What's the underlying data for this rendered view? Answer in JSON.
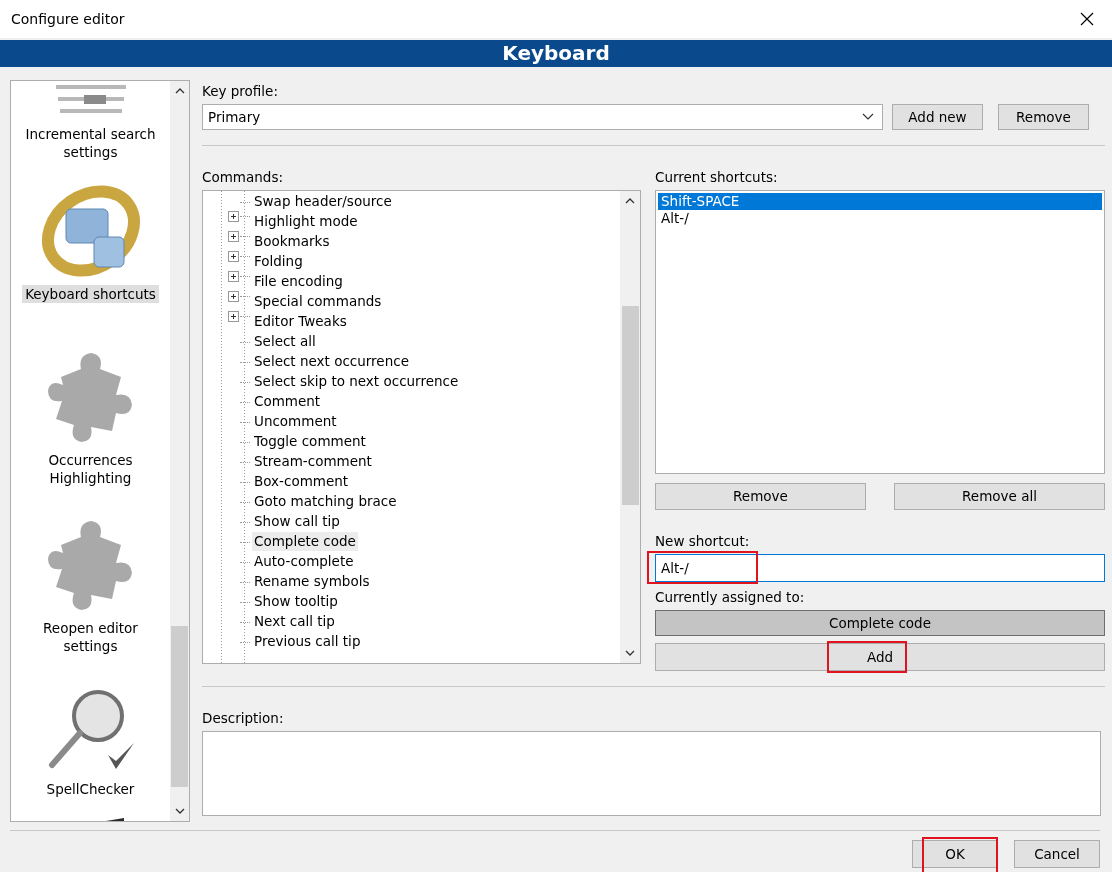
{
  "window": {
    "title": "Configure editor"
  },
  "header": {
    "title": "Keyboard"
  },
  "sidebar": {
    "items": [
      {
        "label": "Incremental search settings",
        "kind": "text",
        "selected": false
      },
      {
        "label": "Keyboard shortcuts",
        "kind": "keyring",
        "selected": true
      },
      {
        "label": "Occurrences Highlighting",
        "kind": "puzzle",
        "selected": false
      },
      {
        "label": "Reopen editor settings",
        "kind": "puzzle",
        "selected": false
      },
      {
        "label": "SpellChecker",
        "kind": "spell",
        "selected": false
      },
      {
        "kind": "toolbar",
        "selected": false
      }
    ]
  },
  "key_profile": {
    "label": "Key profile:",
    "value": "Primary",
    "buttons": [
      {
        "label": "Add new"
      },
      {
        "label": "Remove"
      }
    ]
  },
  "commands": {
    "label": "Commands:",
    "items": [
      {
        "label": "Swap header/source",
        "kind": "leaf",
        "selected": false
      },
      {
        "label": "Highlight mode",
        "kind": "group",
        "expanded": false,
        "selected": false
      },
      {
        "label": "Bookmarks",
        "kind": "group",
        "expanded": false,
        "selected": false
      },
      {
        "label": "Folding",
        "kind": "group",
        "expanded": false,
        "selected": false
      },
      {
        "label": "File encoding",
        "kind": "group",
        "expanded": false,
        "selected": false
      },
      {
        "label": "Special commands",
        "kind": "group",
        "expanded": false,
        "selected": false
      },
      {
        "label": "Editor Tweaks",
        "kind": "group",
        "expanded": false,
        "selected": false
      },
      {
        "label": "Select all",
        "kind": "leaf",
        "selected": false
      },
      {
        "label": "Select next occurrence",
        "kind": "leaf",
        "selected": false
      },
      {
        "label": "Select skip to next occurrence",
        "kind": "leaf",
        "selected": false
      },
      {
        "label": "Comment",
        "kind": "leaf",
        "selected": false
      },
      {
        "label": "Uncomment",
        "kind": "leaf",
        "selected": false
      },
      {
        "label": "Toggle comment",
        "kind": "leaf",
        "selected": false
      },
      {
        "label": "Stream-comment",
        "kind": "leaf",
        "selected": false
      },
      {
        "label": "Box-comment",
        "kind": "leaf",
        "selected": false
      },
      {
        "label": "Goto matching brace",
        "kind": "leaf",
        "selected": false
      },
      {
        "label": "Show call tip",
        "kind": "leaf",
        "selected": false
      },
      {
        "label": "Complete code",
        "kind": "leaf",
        "selected": true
      },
      {
        "label": "Auto-complete",
        "kind": "leaf",
        "selected": false
      },
      {
        "label": "Rename symbols",
        "kind": "leaf",
        "selected": false
      },
      {
        "label": "Show tooltip",
        "kind": "leaf",
        "selected": false
      },
      {
        "label": "Next call tip",
        "kind": "leaf",
        "selected": false
      },
      {
        "label": "Previous call tip",
        "kind": "leaf",
        "selected": false
      }
    ]
  },
  "current_shortcuts": {
    "label": "Current shortcuts:",
    "items": [
      {
        "label": "Shift-SPACE",
        "selected": true
      },
      {
        "label": "Alt-/",
        "selected": false
      }
    ],
    "buttons": [
      {
        "label": "Remove"
      },
      {
        "label": "Remove all"
      }
    ]
  },
  "new_shortcut": {
    "label": "New shortcut:",
    "value": "Alt-/",
    "annotated": true
  },
  "currently_assigned": {
    "label": "Currently assigned to:",
    "value": "Complete code"
  },
  "add_button": {
    "label": "Add",
    "annotated": true
  },
  "description": {
    "label": "Description:"
  },
  "footer_buttons": [
    {
      "label": "OK",
      "annotated": true
    },
    {
      "label": "Cancel",
      "annotated": false
    }
  ]
}
